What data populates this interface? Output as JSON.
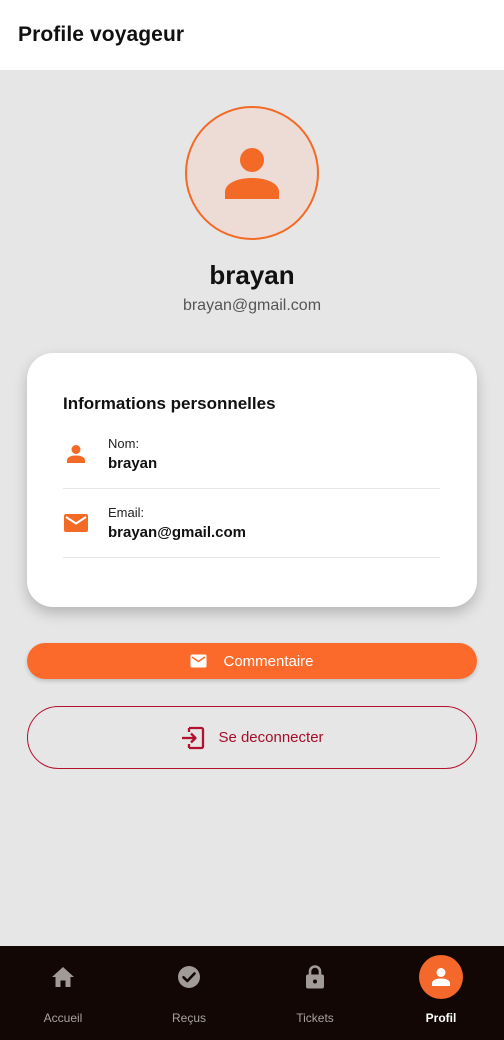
{
  "app_bar": {
    "title": "Profile voyageur"
  },
  "profile": {
    "avatar_icon": "person-icon",
    "name": "brayan",
    "email": "brayan@gmail.com"
  },
  "info_card": {
    "title": "Informations personnelles",
    "rows": [
      {
        "icon": "person-icon",
        "label": "Nom:",
        "value": "brayan"
      },
      {
        "icon": "mail-icon",
        "label": "Email:",
        "value": "brayan@gmail.com"
      }
    ]
  },
  "actions": {
    "comment_label": "Commentaire",
    "logout_label": "Se deconnecter"
  },
  "bottom_nav": {
    "items": [
      {
        "label": "Accueil",
        "icon": "home-icon",
        "active": false
      },
      {
        "label": "Reçus",
        "icon": "check-circle-icon",
        "active": false
      },
      {
        "label": "Tickets",
        "icon": "lock-icon",
        "active": false
      },
      {
        "label": "Profil",
        "icon": "person-icon",
        "active": true
      }
    ]
  },
  "colors": {
    "accent": "#fb6a2a",
    "logout": "#a50e2a",
    "background": "#e7e6e6",
    "nav_background": "#120705"
  }
}
